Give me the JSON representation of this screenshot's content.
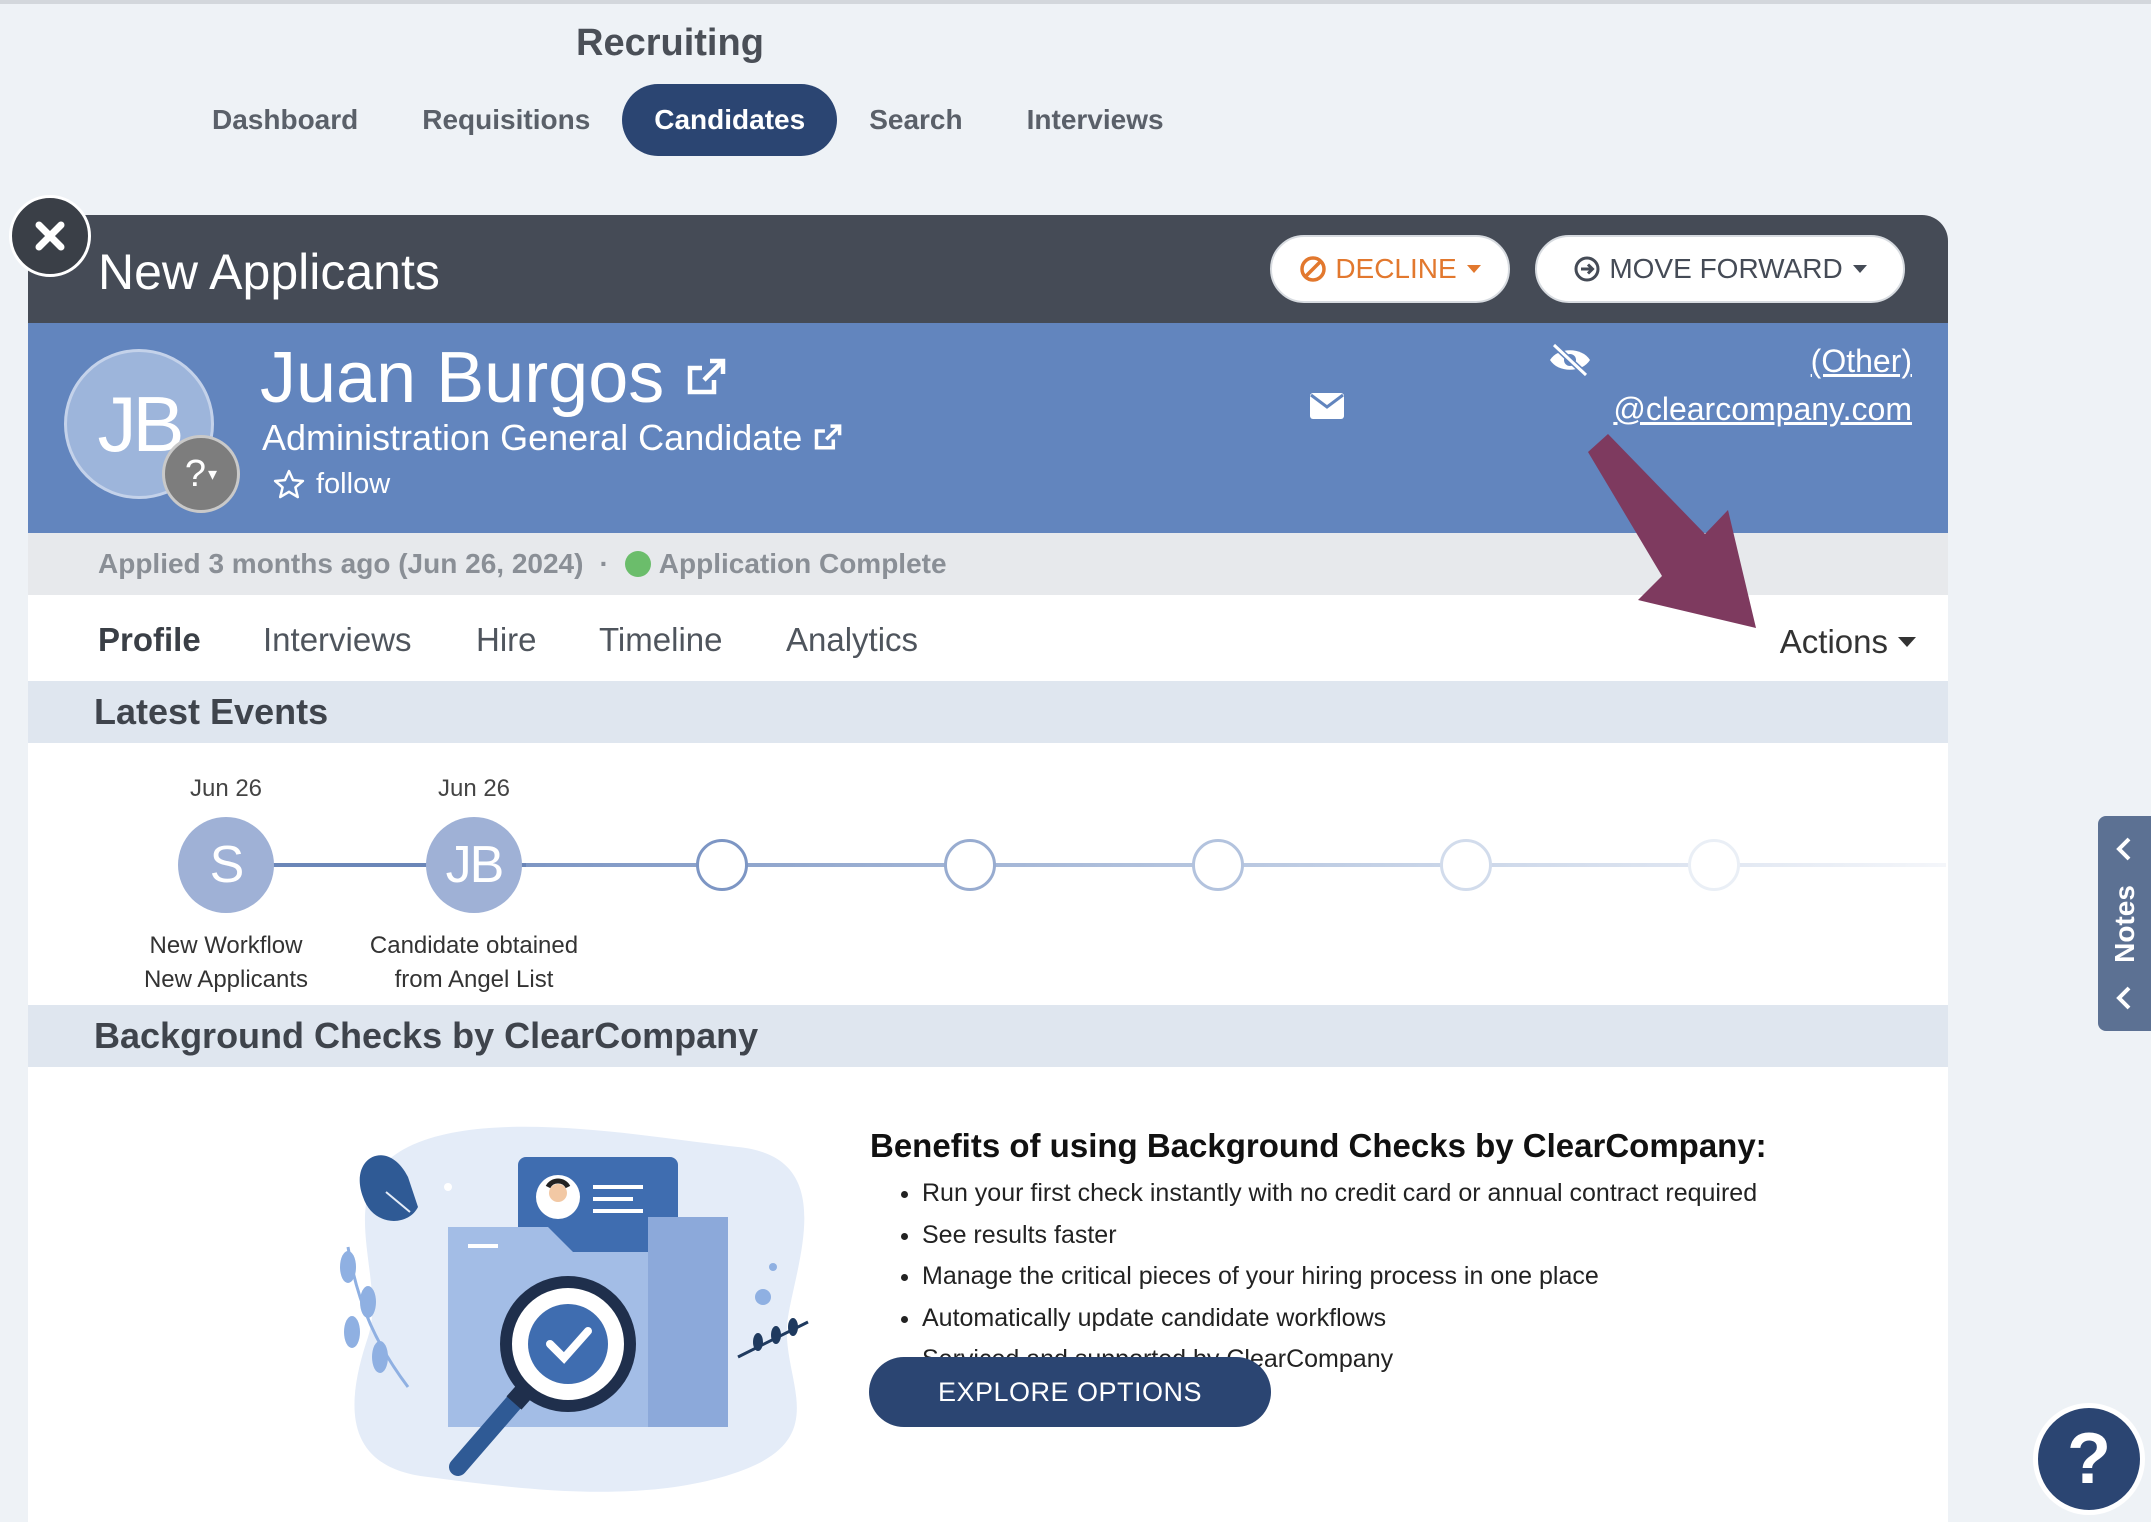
{
  "app": {
    "title": "Recruiting"
  },
  "nav": {
    "items": [
      "Dashboard",
      "Requisitions",
      "Candidates",
      "Search",
      "Interviews"
    ],
    "active": "Candidates"
  },
  "panel": {
    "title": "New Applicants",
    "decline_label": "DECLINE",
    "move_forward_label": "MOVE FORWARD"
  },
  "candidate": {
    "initials": "JB",
    "name": "Juan Burgos",
    "role": "Administration General Candidate",
    "follow_label": "follow",
    "phone_text": "(Other)",
    "email_text": "@clearcompany.com"
  },
  "status": {
    "applied": "Applied 3 months ago (Jun 26, 2024)",
    "separator": "·",
    "application": "Application Complete"
  },
  "tabs": {
    "items": [
      "Profile",
      "Interviews",
      "Hire",
      "Timeline",
      "Analytics"
    ],
    "active": "Profile",
    "actions_label": "Actions"
  },
  "latest_events": {
    "title": "Latest Events",
    "events": [
      {
        "date": "Jun 26",
        "initials": "S",
        "line1": "New Workflow",
        "line2": "New Applicants"
      },
      {
        "date": "Jun 26",
        "initials": "JB",
        "line1": "Candidate obtained",
        "line2": "from Angel List"
      }
    ]
  },
  "background_checks": {
    "title": "Background Checks by ClearCompany",
    "benefits_title": "Benefits of using Background Checks by ClearCompany:",
    "benefits": [
      "Run your first check instantly with no credit card or annual contract required",
      "See results faster",
      "Manage the critical pieces of your hiring process in one place",
      "Automatically update candidate workflows",
      "Serviced and supported by ClearCompany"
    ],
    "cta_label": "EXPLORE OPTIONS"
  },
  "side": {
    "notes_label": "Notes",
    "help_label": "?"
  },
  "colors": {
    "navy": "#2b4572",
    "candidate_bar": "#6285be",
    "header": "#454b56",
    "decline": "#e2782e",
    "annotation_arrow": "#7e3a5f"
  }
}
